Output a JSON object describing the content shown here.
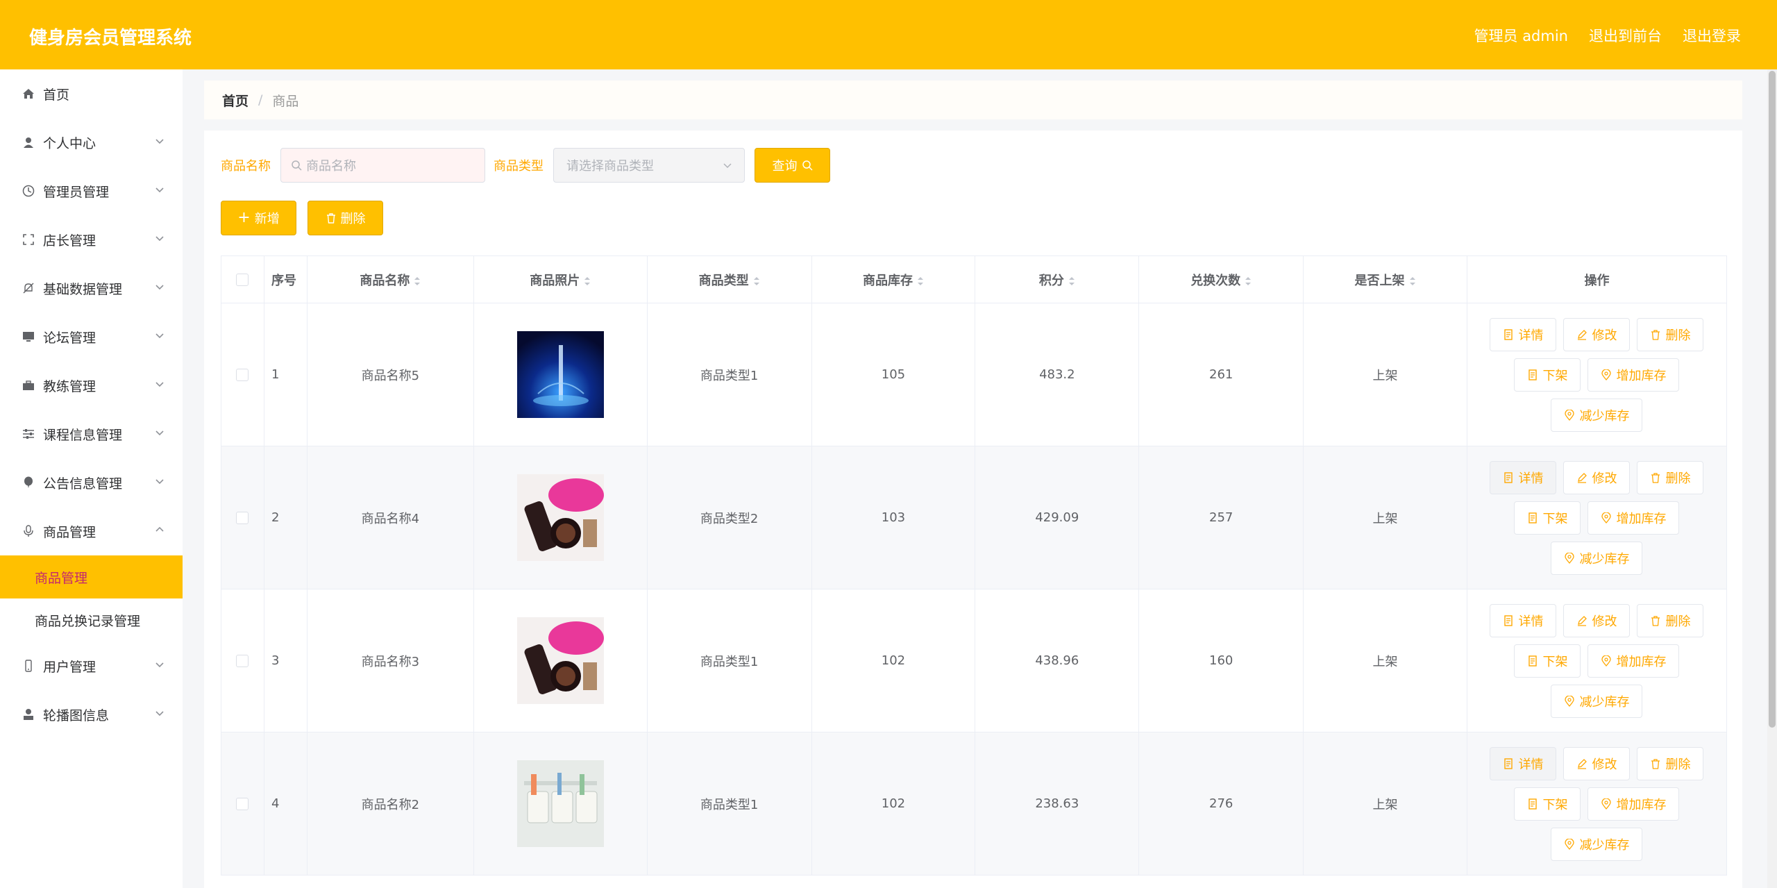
{
  "header": {
    "title": "健身房会员管理系统",
    "user_label": "管理员 admin",
    "to_front": "退出到前台",
    "logout": "退出登录"
  },
  "sidebar": {
    "items": [
      {
        "label": "首页",
        "icon": "home-icon"
      },
      {
        "label": "个人中心",
        "icon": "user-icon"
      },
      {
        "label": "管理员管理",
        "icon": "clock-icon"
      },
      {
        "label": "店长管理",
        "icon": "fullscreen-icon"
      },
      {
        "label": "基础数据管理",
        "icon": "bell-off-icon"
      },
      {
        "label": "论坛管理",
        "icon": "monitor-icon"
      },
      {
        "label": "教练管理",
        "icon": "suitcase-icon"
      },
      {
        "label": "课程信息管理",
        "icon": "sliders-icon"
      },
      {
        "label": "公告信息管理",
        "icon": "balloon-icon"
      },
      {
        "label": "商品管理",
        "icon": "microphone-icon"
      },
      {
        "label": "用户管理",
        "icon": "phone-icon"
      },
      {
        "label": "轮播图信息",
        "icon": "avatar-icon"
      }
    ],
    "sub_items": [
      {
        "label": "商品管理"
      },
      {
        "label": "商品兑换记录管理"
      }
    ]
  },
  "breadcrumb": {
    "home": "首页",
    "sep": "/",
    "current": "商品"
  },
  "search": {
    "name_label": "商品名称",
    "name_placeholder": "商品名称",
    "type_label": "商品类型",
    "type_placeholder": "请选择商品类型",
    "query_label": "查询"
  },
  "actions": {
    "add_label": "新增",
    "delete_label": "删除"
  },
  "table": {
    "headers": [
      "序号",
      "商品名称",
      "商品照片",
      "商品类型",
      "商品库存",
      "积分",
      "兑换次数",
      "是否上架",
      "操作"
    ],
    "rows": [
      {
        "no": "1",
        "name": "商品名称5",
        "photo": "blue-product",
        "type": "商品类型1",
        "stock": "105",
        "points": "483.2",
        "exchanges": "261",
        "status": "上架"
      },
      {
        "no": "2",
        "name": "商品名称4",
        "photo": "cosmetics",
        "type": "商品类型2",
        "stock": "103",
        "points": "429.09",
        "exchanges": "257",
        "status": "上架"
      },
      {
        "no": "3",
        "name": "商品名称3",
        "photo": "cosmetics",
        "type": "商品类型1",
        "stock": "102",
        "points": "438.96",
        "exchanges": "160",
        "status": "上架"
      },
      {
        "no": "4",
        "name": "商品名称2",
        "photo": "shelf",
        "type": "商品类型1",
        "stock": "102",
        "points": "238.63",
        "exchanges": "276",
        "status": "上架"
      }
    ],
    "ops": {
      "detail": "详情",
      "edit": "修改",
      "delete": "删除",
      "offshelf": "下架",
      "add_stock": "增加库存",
      "reduce_stock": "减少库存"
    }
  },
  "colors": {
    "accent": "#ffc000",
    "accent_text": "#ffa800",
    "active_sub_text": "#c4286e"
  }
}
